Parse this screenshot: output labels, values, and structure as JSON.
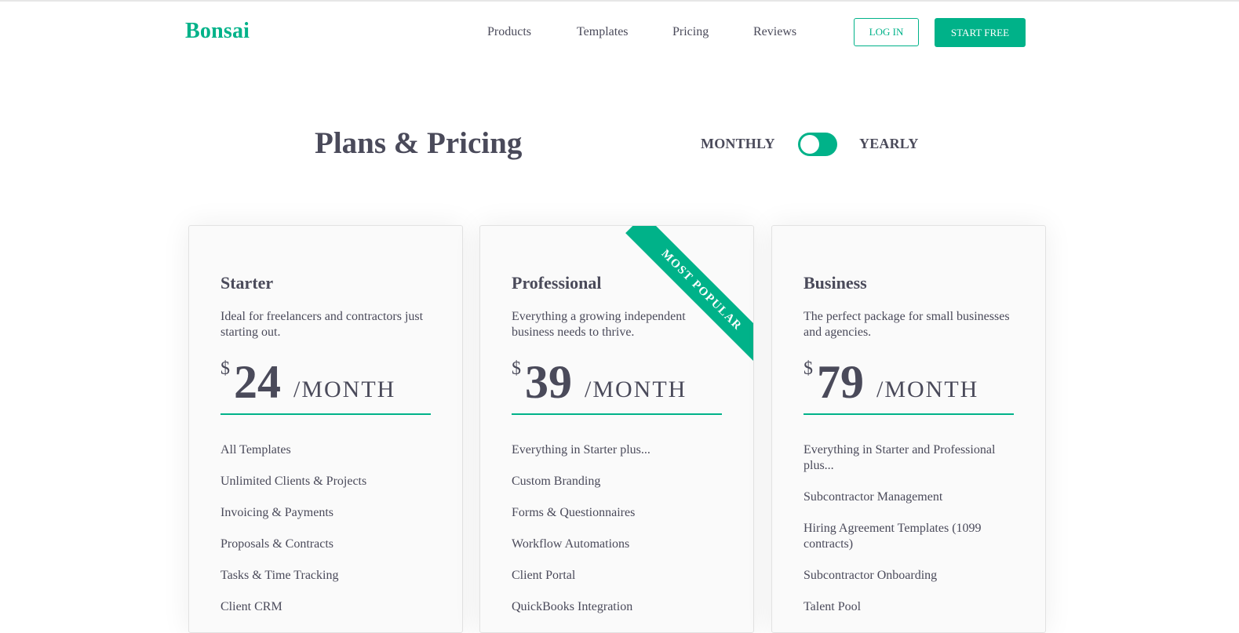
{
  "header": {
    "logo": "Bonsai",
    "nav": [
      "Products",
      "Templates",
      "Pricing",
      "Reviews"
    ],
    "login_label": "LOG IN",
    "start_label": "START FREE"
  },
  "hero": {
    "title": "Plans & Pricing",
    "billing_monthly": "MONTHLY",
    "billing_yearly": "YEARLY",
    "billing_selected": "MONTHLY"
  },
  "plans": [
    {
      "name": "Starter",
      "description": "Ideal for freelancers and contractors just starting out.",
      "currency": "$",
      "price": "24",
      "period": "/MONTH",
      "features": [
        "All Templates",
        "Unlimited Clients & Projects",
        "Invoicing & Payments",
        "Proposals & Contracts",
        "Tasks & Time Tracking",
        "Client CRM"
      ]
    },
    {
      "name": "Professional",
      "ribbon": "MOST POPULAR",
      "description": "Everything a growing independent business needs to thrive.",
      "currency": "$",
      "price": "39",
      "period": "/MONTH",
      "features": [
        "Everything in Starter plus...",
        "Custom Branding",
        "Forms & Questionnaires",
        "Workflow Automations",
        "Client Portal",
        "QuickBooks Integration"
      ]
    },
    {
      "name": "Business",
      "description": "The perfect package for small businesses and agencies.",
      "currency": "$",
      "price": "79",
      "period": "/MONTH",
      "features": [
        "Everything in Starter and Professional plus...",
        "Subcontractor Management",
        "Hiring Agreement Templates (1099 contracts)",
        "Subcontractor Onboarding",
        "Talent Pool"
      ]
    }
  ],
  "colors": {
    "accent": "#00b289",
    "text": "#4a4a5a",
    "card_bg": "#fafafa"
  }
}
